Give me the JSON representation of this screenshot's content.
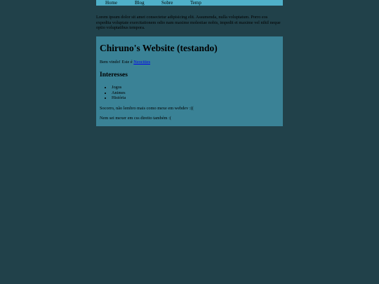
{
  "nav": {
    "items": [
      {
        "label": "Home"
      },
      {
        "label": "Blog"
      },
      {
        "label": "Sobre"
      },
      {
        "label": "Temp"
      }
    ]
  },
  "intro": {
    "text": "Lorem ipsum dolor sit amet consectetur adipisicing elit. Assumenda, nulla voluptatum. Porro eos expedita voluptate exercitationem odio nam maxime molestiae nobis, impedit et maxime vel nihil neque optio voluptatibus tempora."
  },
  "card": {
    "title": "Chiruno's Website (testando)",
    "welcome_prefix": "Bem vindo! Este é ",
    "welcome_link": "Neocities",
    "interests_heading": "Interesses",
    "interests": [
      "Jogos",
      "Animes",
      "História"
    ],
    "line1": "Socorro, não lembro mais como mexe em webdev :((",
    "line2": "Nem sei mexer em css direito também :("
  },
  "colors": {
    "background": "#21414a",
    "navbar": "#4fb0c9",
    "card": "#3a8296",
    "link": "#0000ee"
  }
}
